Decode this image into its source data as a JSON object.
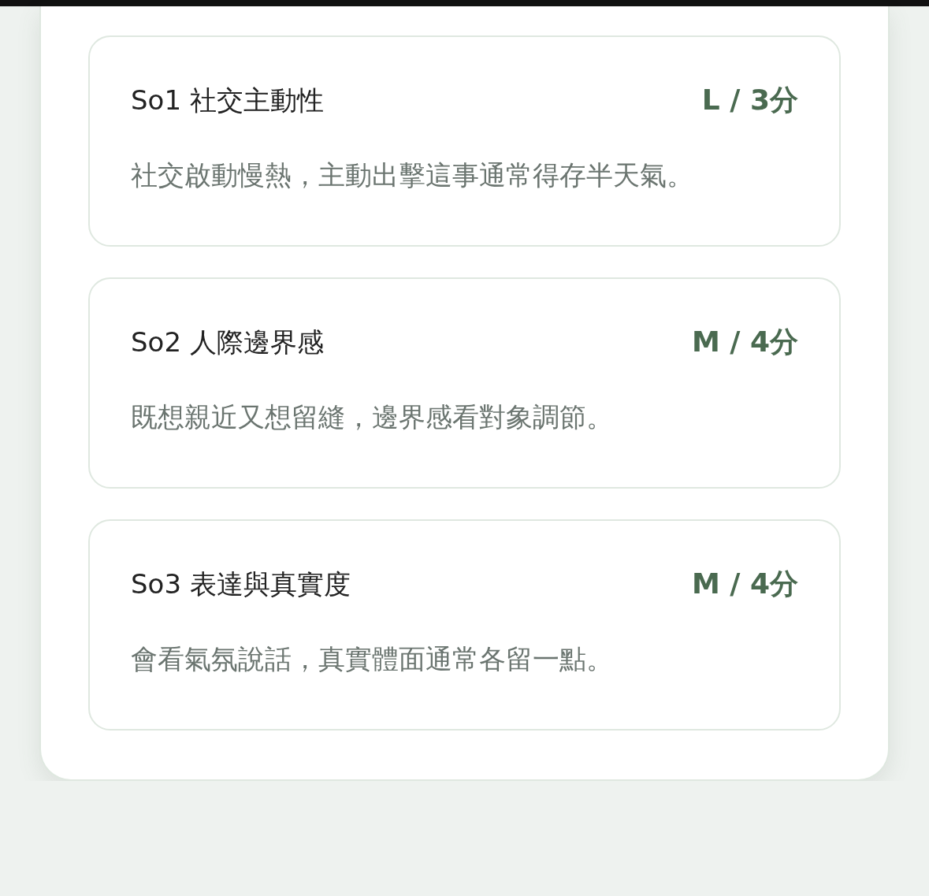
{
  "cards": [
    {
      "title": "So1 社交主動性",
      "score": "L / 3分",
      "description": "社交啟動慢熱，主動出擊這事通常得存半天氣。"
    },
    {
      "title": "So2 人際邊界感",
      "score": "M / 4分",
      "description": "既想親近又想留縫，邊界感看對象調節。"
    },
    {
      "title": "So3 表達與真實度",
      "score": "M / 4分",
      "description": "會看氣氛說話，真實體面通常各留一點。"
    }
  ]
}
